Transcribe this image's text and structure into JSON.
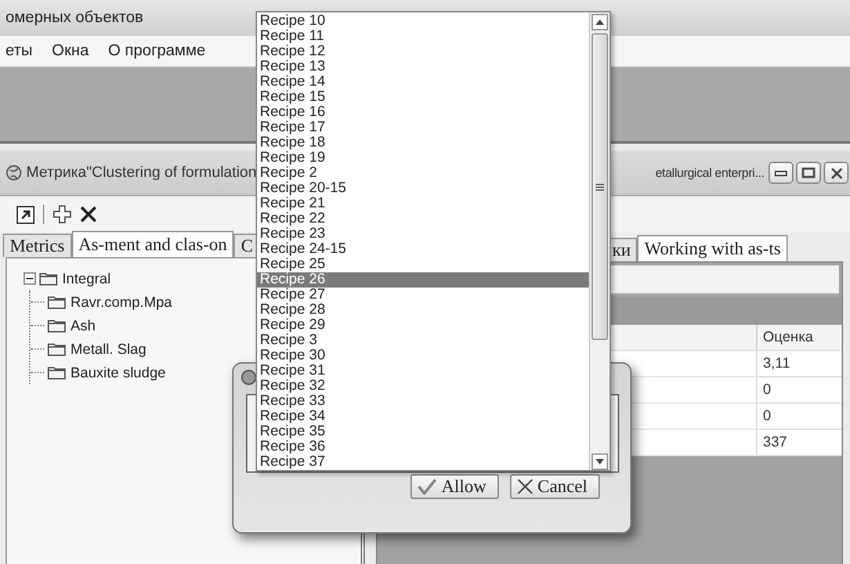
{
  "app_title": "омерных объектов",
  "menu": [
    "еты",
    "Окна",
    "О программе"
  ],
  "child_window": {
    "title": "Метрика\"Clustering of formulation",
    "title_end": "etallurgical enterpri..."
  },
  "left_tabs": [
    {
      "label": "Metrics",
      "selected": false
    },
    {
      "label": "As-ment and clas-on",
      "selected": true
    },
    {
      "label": "C",
      "selected": false
    }
  ],
  "tree": [
    {
      "label": "Integral",
      "expanded": true,
      "children": [
        {
          "label": "Ravr.comp.Mpa"
        },
        {
          "label": "Ash"
        },
        {
          "label": "Metall. Slag"
        },
        {
          "label": "Bauxite sludge"
        }
      ]
    }
  ],
  "right_tabs": [
    {
      "label": "ки",
      "selected": false
    },
    {
      "label": "Working with as-ts",
      "selected": true
    }
  ],
  "table": {
    "columns": [
      "Оценка"
    ],
    "rows": [
      [
        "3,11"
      ],
      [
        "0"
      ],
      [
        "0"
      ],
      [
        "337"
      ]
    ]
  },
  "dropdown": {
    "items": [
      {
        "label": "Recipe 10",
        "selected": false
      },
      {
        "label": "Recipe 11",
        "selected": false
      },
      {
        "label": "Recipe 12",
        "selected": false
      },
      {
        "label": "Recipe 13",
        "selected": false
      },
      {
        "label": "Recipe 14",
        "selected": false
      },
      {
        "label": "Recipe 15",
        "selected": false
      },
      {
        "label": "Recipe 16",
        "selected": false
      },
      {
        "label": "Recipe 17",
        "selected": false
      },
      {
        "label": "Recipe 18",
        "selected": false
      },
      {
        "label": "Recipe 19",
        "selected": false
      },
      {
        "label": "Recipe 2",
        "selected": false
      },
      {
        "label": "Recipe 20-15",
        "selected": false
      },
      {
        "label": "Recipe 21",
        "selected": false
      },
      {
        "label": "Recipe 22",
        "selected": false
      },
      {
        "label": "Recipe 23",
        "selected": false
      },
      {
        "label": "Recipe 24-15",
        "selected": false
      },
      {
        "label": "Recipe 25",
        "selected": false
      },
      {
        "label": "Recipe 26",
        "selected": true
      },
      {
        "label": "Recipe 27",
        "selected": false
      },
      {
        "label": "Recipe 28",
        "selected": false
      },
      {
        "label": "Recipe 29",
        "selected": false
      },
      {
        "label": "Recipe 3",
        "selected": false
      },
      {
        "label": "Recipe 30",
        "selected": false
      },
      {
        "label": "Recipe 31",
        "selected": false
      },
      {
        "label": "Recipe 32",
        "selected": false
      },
      {
        "label": "Recipe 33",
        "selected": false
      },
      {
        "label": "Recipe 34",
        "selected": false
      },
      {
        "label": "Recipe 35",
        "selected": false
      },
      {
        "label": "Recipe 36",
        "selected": false
      },
      {
        "label": "Recipe 37",
        "selected": false
      }
    ]
  },
  "dialog": {
    "buttons": [
      {
        "label": "Allow",
        "kind": "allow"
      },
      {
        "label": "Cancel",
        "kind": "cancel"
      }
    ]
  }
}
